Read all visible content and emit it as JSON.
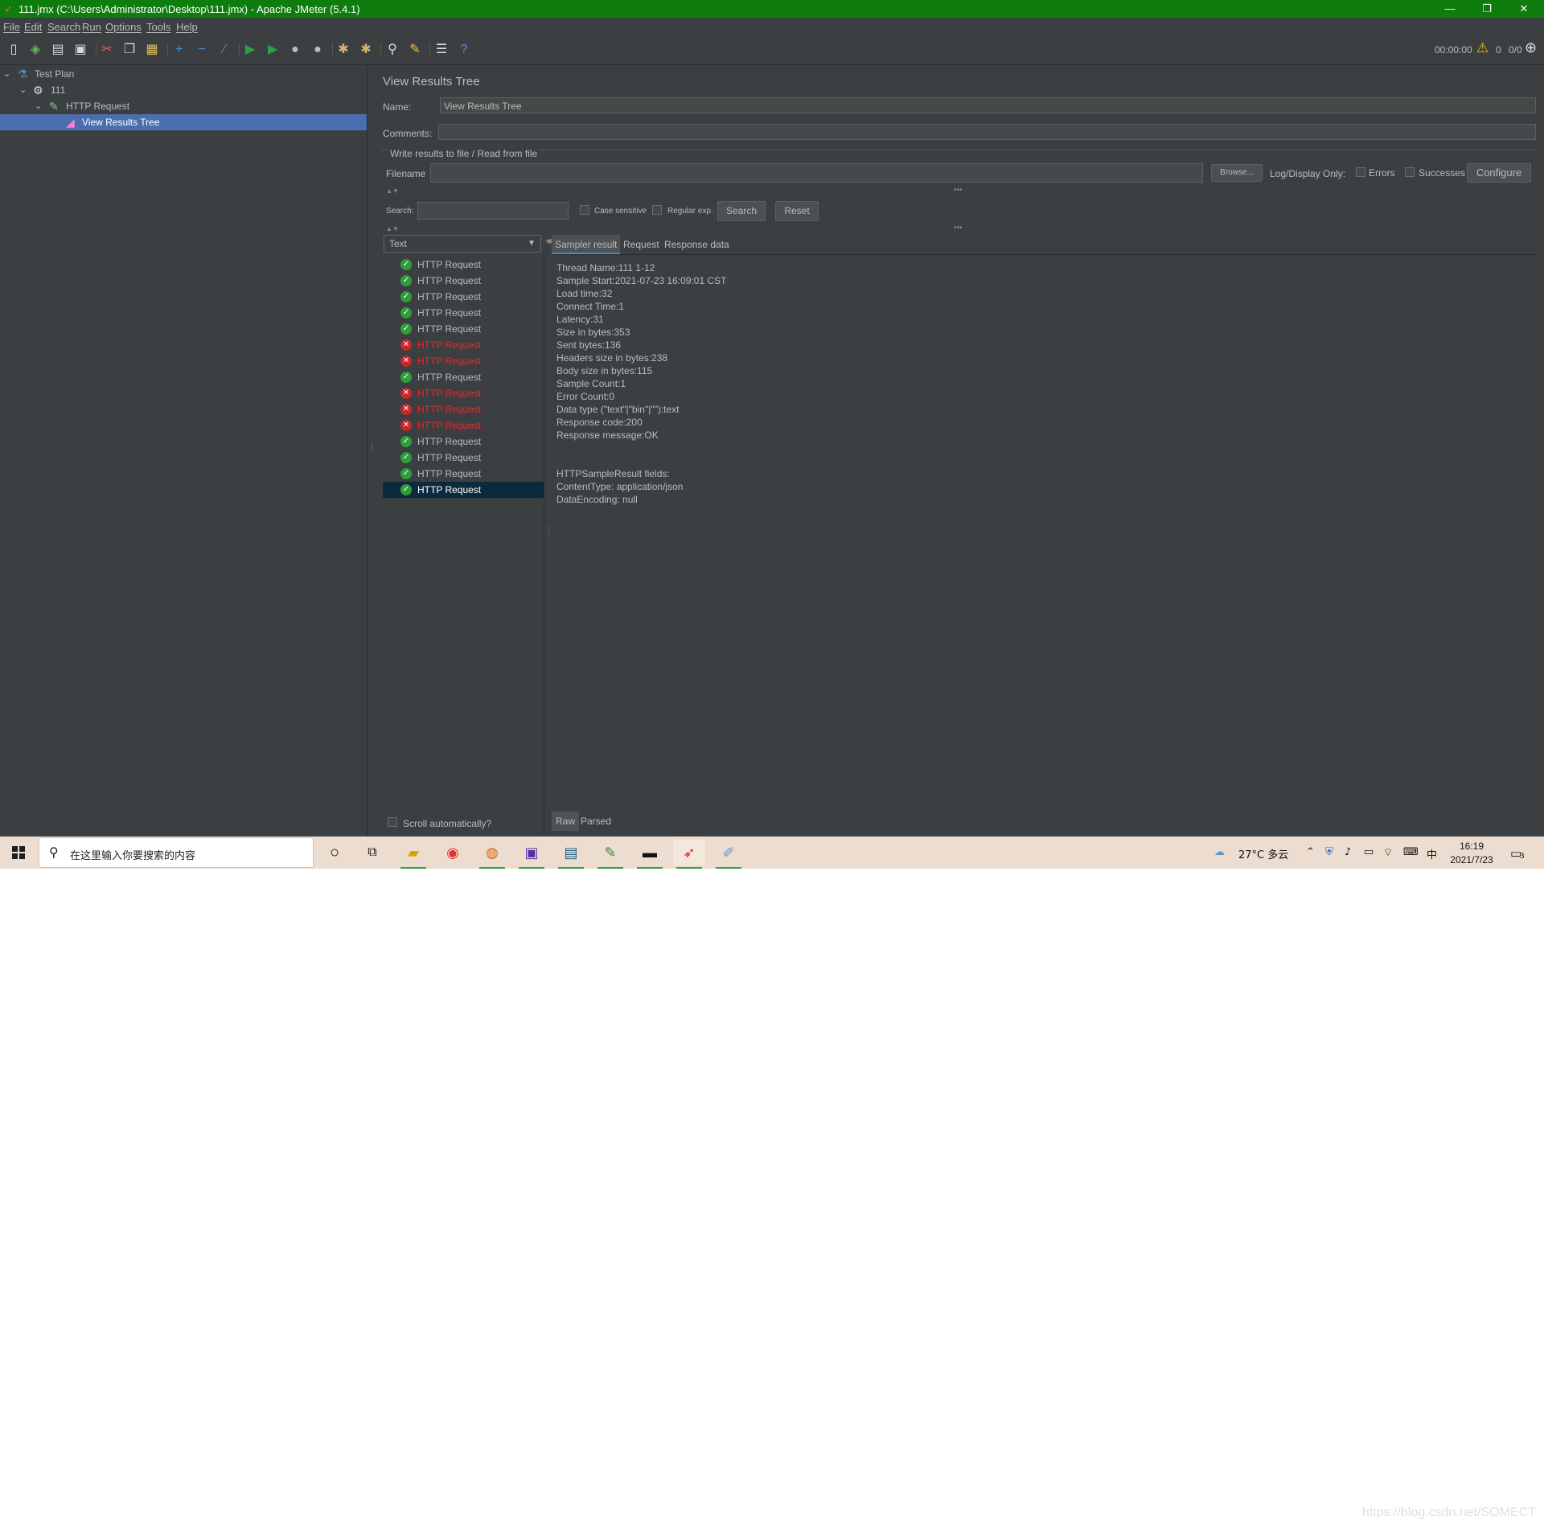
{
  "window": {
    "title": "111.jmx (C:\\Users\\Administrator\\Desktop\\111.jmx) - Apache JMeter (5.4.1)",
    "minimize": "—",
    "restore": "❐",
    "close": "✕"
  },
  "menu": [
    "File",
    "Edit",
    "Search",
    "Run",
    "Options",
    "Tools",
    "Help"
  ],
  "toolbar": {
    "icons": [
      "new-icon",
      "templates-icon",
      "open-icon",
      "save-icon",
      "cut-icon",
      "copy-icon",
      "paste-icon",
      "expand-icon",
      "collapse-icon",
      "toggle-icon",
      "start-icon",
      "start-no-pauses-icon",
      "stop-icon",
      "shutdown-icon",
      "clear-icon",
      "clear-all-icon",
      "search-icon",
      "reset-search-icon",
      "function-helper-icon",
      "help-icon"
    ],
    "elapsed": "00:00:00",
    "warnings": "0",
    "threads": "0/0"
  },
  "tree": [
    {
      "label": "Test Plan",
      "icon": "test-plan-icon"
    },
    {
      "label": "111",
      "icon": "thread-group-icon"
    },
    {
      "label": "HTTP Request",
      "icon": "sampler-icon"
    },
    {
      "label": "View Results Tree",
      "icon": "listener-icon"
    }
  ],
  "panel": {
    "title": "View Results Tree",
    "name_label": "Name:",
    "name_value": "View Results Tree",
    "comments_label": "Comments:",
    "comments_value": "",
    "file_group_title": "Write results to file / Read from file",
    "filename_label": "Filename",
    "filename_value": "",
    "browse_label": "Browse...",
    "log_display_label": "Log/Display Only:",
    "errors_label": "Errors",
    "successes_label": "Successes",
    "configure_label": "Configure",
    "search_label": "Search:",
    "search_value": "",
    "case_sensitive_label": "Case sensitive",
    "regexp_label": "Regular exp.",
    "search_button": "Search",
    "reset_button": "Reset",
    "renderer_value": "Text",
    "scroll_auto_label": "Scroll automatically?"
  },
  "results": [
    {
      "label": "HTTP Request",
      "status": "ok"
    },
    {
      "label": "HTTP Request",
      "status": "ok"
    },
    {
      "label": "HTTP Request",
      "status": "ok"
    },
    {
      "label": "HTTP Request",
      "status": "ok"
    },
    {
      "label": "HTTP Request",
      "status": "ok"
    },
    {
      "label": "HTTP Request",
      "status": "err"
    },
    {
      "label": "HTTP Request",
      "status": "err"
    },
    {
      "label": "HTTP Request",
      "status": "ok"
    },
    {
      "label": "HTTP Request",
      "status": "err"
    },
    {
      "label": "HTTP Request",
      "status": "err"
    },
    {
      "label": "HTTP Request",
      "status": "err"
    },
    {
      "label": "HTTP Request",
      "status": "ok"
    },
    {
      "label": "HTTP Request",
      "status": "ok"
    },
    {
      "label": "HTTP Request",
      "status": "ok"
    },
    {
      "label": "HTTP Request",
      "status": "ok",
      "selected": true
    }
  ],
  "detail_tabs": [
    "Sampler result",
    "Request",
    "Response data"
  ],
  "sampler_result": "Thread Name:111 1-12\nSample Start:2021-07-23 16:09:01 CST\nLoad time:32\nConnect Time:1\nLatency:31\nSize in bytes:353\nSent bytes:136\nHeaders size in bytes:238\nBody size in bytes:115\nSample Count:1\nError Count:0\nData type (\"text\"|\"bin\"|\"\"):text\nResponse code:200\nResponse message:OK\n\n\nHTTPSampleResult fields:\nContentType: application/json\nDataEncoding: null",
  "bottom_tabs": [
    "Raw",
    "Parsed"
  ],
  "taskbar": {
    "search_placeholder": "在这里输入你要搜索的内容",
    "weather": "27°C 多云",
    "ime": "中",
    "time": "16:19",
    "date": "2021/7/23",
    "notifications": "3"
  },
  "watermark": "https://blog.csdn.net/SOMECT",
  "colors": {
    "titlebar": "#0e7d0e",
    "panel_bg": "#3c3f41",
    "selection": "#4b6eaf",
    "error_text": "#ff2020",
    "success_icon": "#2f9d3a"
  }
}
